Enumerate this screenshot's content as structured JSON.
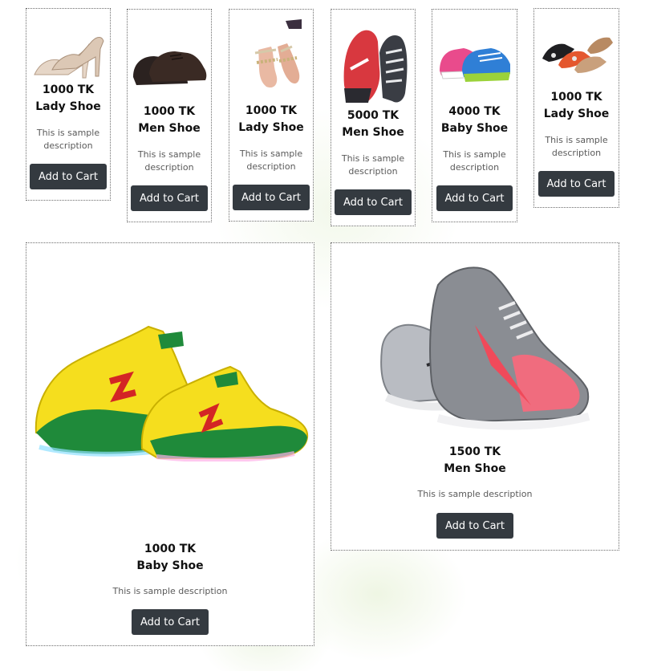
{
  "products": [
    {
      "price": "1000 TK",
      "name": "Lady Shoe",
      "description": "This is sample description",
      "button": "Add to Cart",
      "image_icon": "beige-heels-icon"
    },
    {
      "price": "1000 TK",
      "name": "Men Shoe",
      "description": "This is sample description",
      "button": "Add to Cart",
      "image_icon": "brown-oxford-icon"
    },
    {
      "price": "1000 TK",
      "name": "Lady Shoe",
      "description": "This is sample description",
      "button": "Add to Cart",
      "image_icon": "sandal-icon"
    },
    {
      "price": "5000 TK",
      "name": "Men Shoe",
      "description": "This is sample description",
      "button": "Add to Cart",
      "image_icon": "red-sneaker-icon"
    },
    {
      "price": "4000 TK",
      "name": "Baby Shoe",
      "description": "This is sample description",
      "button": "Add to Cart",
      "image_icon": "kids-sneaker-icon"
    },
    {
      "price": "1000 TK",
      "name": "Lady Shoe",
      "description": "This is sample description",
      "button": "Add to Cart",
      "image_icon": "flats-icon"
    },
    {
      "price": "1000 TK",
      "name": "Baby Shoe",
      "description": "This is sample description",
      "button": "Add to Cart",
      "image_icon": "led-kids-sneaker-icon"
    },
    {
      "price": "1500 TK",
      "name": "Men Shoe",
      "description": "This is sample description",
      "button": "Add to Cart",
      "image_icon": "grey-running-shoe-icon"
    }
  ],
  "colors": {
    "button_bg": "#343a40",
    "button_text": "#ffffff",
    "card_border": "#6d6d6d"
  }
}
